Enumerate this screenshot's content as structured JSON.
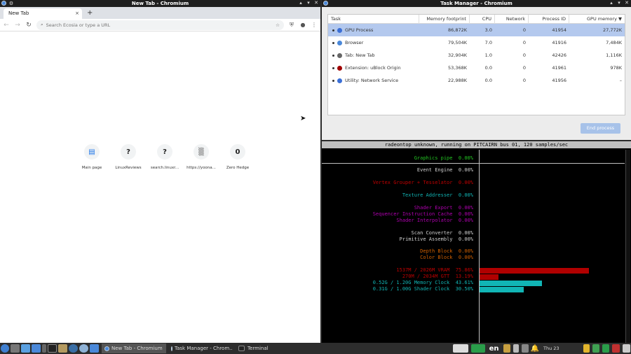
{
  "left_window": {
    "title": "New Tab - Chromium",
    "tab_label": "New Tab",
    "tab_close": "×",
    "new_tab": "+",
    "omnibox_placeholder": "Search Ecosia or type a URL",
    "shortcuts": [
      {
        "label": "Main page",
        "glyph": "▤",
        "color": "#1a73e8"
      },
      {
        "label": "LinuxReviews",
        "glyph": "?",
        "color": "#222"
      },
      {
        "label": "search.linuxr...",
        "glyph": "?",
        "color": "#222"
      },
      {
        "label": "https://yoona...",
        "glyph": "▒",
        "color": "#777"
      },
      {
        "label": "Zero Hedge",
        "glyph": "0",
        "color": "#222"
      }
    ]
  },
  "task_manager": {
    "title": "Task Manager - Chromium",
    "columns": [
      "Task",
      "Memory footprint",
      "CPU",
      "Network",
      "Process ID",
      "GPU memory ▼"
    ],
    "rows": [
      {
        "task": "GPU Process",
        "mem": "86,872K",
        "cpu": "3.0",
        "net": "0",
        "pid": "41954",
        "gpu": "27,772K",
        "icon_color": "#3b6fd6",
        "selected": true
      },
      {
        "task": "Browser",
        "mem": "79,504K",
        "cpu": "7.0",
        "net": "0",
        "pid": "41916",
        "gpu": "7,484K",
        "icon_color": "#4a88d9",
        "selected": false
      },
      {
        "task": "Tab: New Tab",
        "mem": "32,904K",
        "cpu": "1.0",
        "net": "0",
        "pid": "42426",
        "gpu": "1,116K",
        "icon_color": "#666",
        "selected": false
      },
      {
        "task": "Extension: uBlock Origin",
        "mem": "53,368K",
        "cpu": "0.0",
        "net": "0",
        "pid": "41961",
        "gpu": "978K",
        "icon_color": "#a00000",
        "selected": false
      },
      {
        "task": "Utility: Network Service",
        "mem": "22,988K",
        "cpu": "0.0",
        "net": "0",
        "pid": "41956",
        "gpu": "–",
        "icon_color": "#3b6fd6",
        "selected": false
      }
    ],
    "end_process": "End process"
  },
  "radeontop": {
    "header": "radeontop unknown, running on PITCAIRN bus 01, 120 samples/sec",
    "rows": [
      {
        "text": "Graphics pipe  0.00%",
        "color": "#22c322",
        "bar": 0,
        "bar_color": "#22c322"
      },
      {
        "text": "Event Engine  0.00%",
        "color": "#d0d0d0",
        "bar": 0,
        "bar_color": "#d0d0d0"
      },
      {
        "text": "Vertex Grouper + Tesselator  0.00%",
        "color": "#c00000",
        "bar": 0,
        "bar_color": "#c00000"
      },
      {
        "text": "Texture Addresser  0.00%",
        "color": "#11b5b5",
        "bar": 0,
        "bar_color": "#11b5b5"
      },
      {
        "text": "Shader Export  0.00%",
        "color": "#b000b0",
        "bar": 0,
        "bar_color": "#b000b0"
      },
      {
        "text": "Sequencer Instruction Cache  0.00%",
        "color": "#b000b0",
        "bar": 0,
        "bar_color": "#b000b0"
      },
      {
        "text": "Shader Interpolator  0.00%",
        "color": "#b000b0",
        "bar": 0,
        "bar_color": "#b000b0"
      },
      {
        "text": "Scan Converter  0.00%",
        "color": "#d0d0d0",
        "bar": 0,
        "bar_color": "#d0d0d0"
      },
      {
        "text": "Primitive Assembly  0.00%",
        "color": "#d0d0d0",
        "bar": 0,
        "bar_color": "#d0d0d0"
      },
      {
        "text": "Depth Block  0.00%",
        "color": "#d06000",
        "bar": 0,
        "bar_color": "#d06000"
      },
      {
        "text": "Color Block  0.00%",
        "color": "#d06000",
        "bar": 0,
        "bar_color": "#d06000"
      },
      {
        "text": "1537M / 2026M VRAM  75.86%",
        "color": "#c00000",
        "bar": 75.86,
        "bar_color": "#b00000"
      },
      {
        "text": "270M / 2034M GTT  13.19%",
        "color": "#c00000",
        "bar": 13.19,
        "bar_color": "#b00000"
      },
      {
        "text": "0.52G / 1.20G Memory Clock  43.61%",
        "color": "#11b5b5",
        "bar": 43.61,
        "bar_color": "#11b5b5"
      },
      {
        "text": "0.31G / 1.00G Shader Clock  30.50%",
        "color": "#11b5b5",
        "bar": 30.5,
        "bar_color": "#11b5b5"
      }
    ]
  },
  "taskbar": {
    "tasks": [
      "New Tab - Chromium",
      "Task Manager - Chrom...",
      "Terminal"
    ],
    "lang": "en",
    "clock": "Thu 23"
  }
}
